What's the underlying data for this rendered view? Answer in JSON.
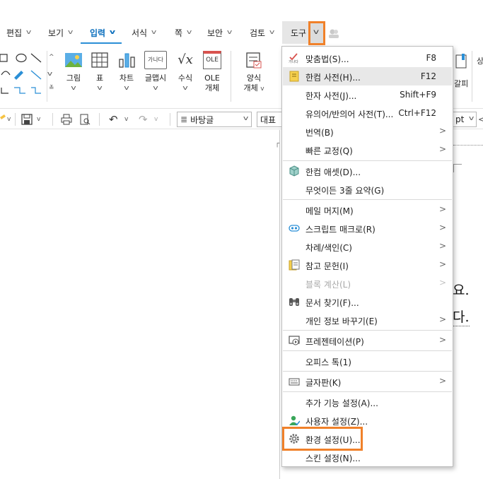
{
  "menubar": {
    "tabs": [
      {
        "label": "편집",
        "active": false
      },
      {
        "label": "보기",
        "active": false
      },
      {
        "label": "입력",
        "active": true
      },
      {
        "label": "서식",
        "active": false
      },
      {
        "label": "쪽",
        "active": false
      },
      {
        "label": "보안",
        "active": false
      },
      {
        "label": "검토",
        "active": false
      },
      {
        "label": "도구",
        "active": false
      }
    ]
  },
  "ribbon": {
    "buttons": [
      {
        "label": "그림"
      },
      {
        "label": "표"
      },
      {
        "label": "차트"
      },
      {
        "label": "글맵시",
        "icon_text": "가나다"
      },
      {
        "label": "수식",
        "icon_text": "√x"
      },
      {
        "label": "OLE",
        "label2": "개체",
        "icon_text": "OLE"
      },
      {
        "label": "양식",
        "label2": "개체"
      }
    ],
    "right_partial": "갈피"
  },
  "toolbar": {
    "style_value": "바탕글",
    "font_value_partial": "대표",
    "unit_partial": "pt"
  },
  "document": {
    "line1_partial": "요.",
    "line2_partial": "다."
  },
  "tools_menu": {
    "items": [
      {
        "label": "맞춤법(S)...",
        "shortcut": "F8",
        "icon": "spellcheck-icon"
      },
      {
        "label": "한컴 사전(H)...",
        "shortcut": "F12",
        "icon": "dictionary-icon",
        "hover": true
      },
      {
        "label": "한자 사전(J)...",
        "shortcut": "Shift+F9"
      },
      {
        "label": "유의어/반의어 사전(T)...",
        "shortcut": "Ctrl+F12"
      },
      {
        "label": "번역(B)",
        "submenu": true
      },
      {
        "label": "빠른 교정(Q)",
        "submenu": true
      },
      {
        "label": "한컴 애셋(D)...",
        "icon": "asset-cube-icon"
      },
      {
        "label": "무엇이든 3줄 요약(G)"
      },
      {
        "label": "메일 머지(M)",
        "submenu": true
      },
      {
        "label": "스크립트 매크로(R)",
        "submenu": true,
        "icon": "macro-icon"
      },
      {
        "label": "차례/색인(C)",
        "submenu": true
      },
      {
        "label": "참고 문헌(I)",
        "submenu": true,
        "icon": "reference-icon"
      },
      {
        "label": "블록 계산(L)",
        "submenu": true,
        "disabled": true
      },
      {
        "label": "문서 찾기(F)...",
        "icon": "binoculars-icon"
      },
      {
        "label": "개인 정보 바꾸기(E)",
        "submenu": true
      },
      {
        "label": "프레젠테이션(P)",
        "submenu": true,
        "icon": "presentation-icon"
      },
      {
        "label": "오피스 톡(1)"
      },
      {
        "label": "글자판(K)",
        "submenu": true,
        "icon": "keyboard-icon"
      },
      {
        "label": "추가 기능 설정(A)..."
      },
      {
        "label": "사용자 설정(Z)...",
        "icon": "user-settings-icon"
      },
      {
        "label": "환경 설정(U)...",
        "icon": "gear-icon",
        "highlighted": true
      },
      {
        "label": "스킨 설정(N)..."
      }
    ]
  },
  "colors": {
    "highlight_orange": "#f0812a",
    "active_tab_blue": "#0a6ebd",
    "menu_hover": "#e8e8e8"
  }
}
